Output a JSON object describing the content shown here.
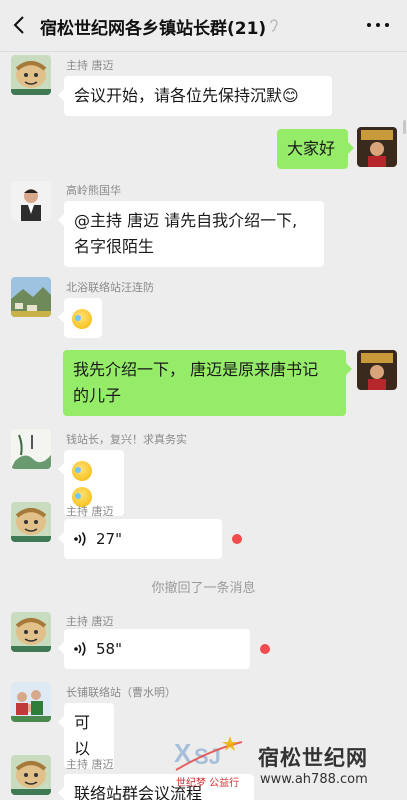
{
  "header": {
    "title": "宿松世纪网各乡镇站长群(21)"
  },
  "messages": [
    {
      "sender": "主持 唐迈",
      "text": "会议开始，请各位先保持沉默😊"
    },
    {
      "text": "大家好"
    },
    {
      "sender": "高岭熊国华",
      "line1": "@主持 唐迈  请先自我介绍一下,",
      "line2": "名字很陌生"
    },
    {
      "sender": "北浴联络站汪连防"
    },
    {
      "line1": "我先介绍一下， 唐迈是原来唐书记",
      "line2": "的儿子"
    },
    {
      "sender": "钱站长，复兴！求真务实"
    },
    {
      "sender": "主持 唐迈",
      "duration": "27\""
    },
    {
      "notice": "你撤回了一条消息"
    },
    {
      "sender": "主持 唐迈",
      "duration": "58\""
    },
    {
      "sender": "长铺联络站（曹水明）",
      "text": "可以"
    },
    {
      "sender": "主持 唐迈",
      "text": "联络站群会议流程"
    }
  ],
  "watermark": {
    "site_name": "宿松世纪网",
    "url": "www.ah788.com",
    "logo_text": "世纪梦 公益行"
  },
  "colors": {
    "background": "#ededed",
    "bubble_self": "#95ec69",
    "bubble_other": "#ffffff",
    "unread_dot": "#f04c4c"
  }
}
